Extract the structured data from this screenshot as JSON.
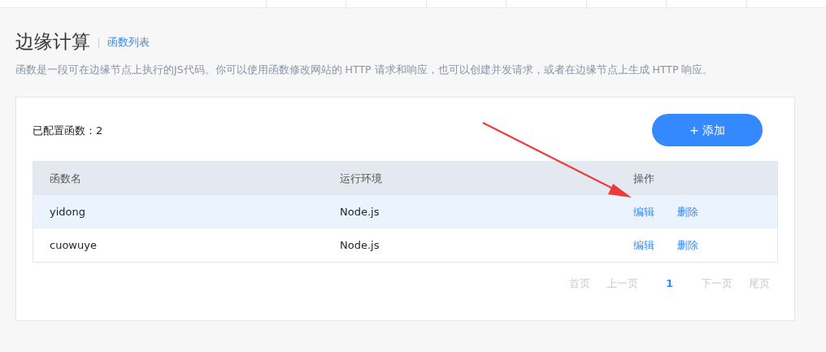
{
  "header": {
    "title": "边缘计算",
    "subtitle_link": "函数列表"
  },
  "description": "函数是一段可在边缘节点上执行的JS代码。你可以使用函数修改网站的 HTTP 请求和响应，也可以创建并发请求，或者在边缘节点上生成 HTTP 响应。",
  "card": {
    "count_label": "已配置函数：2",
    "add_button": "+ 添加",
    "table": {
      "columns": [
        "函数名",
        "运行环境",
        "操作"
      ],
      "rows": [
        {
          "name": "yidong",
          "runtime": "Node.js",
          "actions": [
            "编辑",
            "删除"
          ],
          "selected": true
        },
        {
          "name": "cuowuye",
          "runtime": "Node.js",
          "actions": [
            "编辑",
            "删除"
          ],
          "selected": false
        }
      ]
    },
    "pagination": [
      {
        "label": "首页",
        "selected": false,
        "disabled": true
      },
      {
        "label": "上一页",
        "selected": false,
        "disabled": true
      },
      {
        "label": "1",
        "selected": true,
        "disabled": false
      },
      {
        "label": "下一页",
        "selected": false,
        "disabled": true
      },
      {
        "label": "尾页",
        "selected": false,
        "disabled": true
      }
    ]
  }
}
